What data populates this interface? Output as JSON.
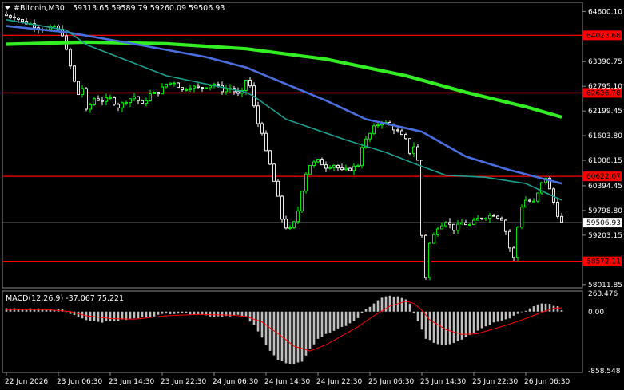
{
  "header": {
    "menu_arrow": "triangle-down-icon",
    "symbol": "#Bitcoin,M30",
    "ohlc": "59313.65 59589.79 59260.09 59506.93"
  },
  "macd_header": "MACD(12,26,9) -37.067 75.221",
  "colors": {
    "background": "#000000",
    "bull": "#00ff00",
    "bear": "#ffffff",
    "ma_fast": "#1e9e8e",
    "ma_mid": "#4a6ee0",
    "ma_slow": "#33ee22",
    "level": "#ff0000",
    "macd_hist": "#c0c0c0",
    "macd_signal": "#ff0000",
    "text": "#ffffff"
  },
  "chart_data": {
    "type": "candlestick",
    "price_ticks": [
      "64600.10",
      "63390.75",
      "62795.10",
      "62199.45",
      "61603.80",
      "61008.15",
      "60394.45",
      "59798.80",
      "59203.15",
      "58011.85"
    ],
    "levels": [
      {
        "label": "64023.68",
        "value": 64023.68
      },
      {
        "label": "62636.78",
        "value": 62636.78
      },
      {
        "label": "60622.07",
        "value": 60622.07
      },
      {
        "label": "58572.11",
        "value": 58572.11
      }
    ],
    "current_price": {
      "label": "59506.93",
      "value": 59506.93
    },
    "x_ticks": [
      "22 Jun 2026",
      "23 Jun 06:30",
      "23 Jun 14:30",
      "23 Jun 22:30",
      "24 Jun 06:30",
      "24 Jun 14:30",
      "24 Jun 22:30",
      "25 Jun 06:30",
      "25 Jun 14:30",
      "25 Jun 22:30",
      "26 Jun 06:30"
    ],
    "ylim": [
      57950,
      64800
    ],
    "close_path": [
      [
        0,
        64500
      ],
      [
        2,
        64480
      ],
      [
        4,
        64350
      ],
      [
        6,
        64300
      ],
      [
        8,
        64200
      ],
      [
        10,
        64150
      ],
      [
        12,
        64250
      ],
      [
        14,
        64050
      ],
      [
        15,
        63650
      ],
      [
        17,
        62900
      ],
      [
        18,
        62600
      ],
      [
        19,
        62750
      ],
      [
        20,
        62200
      ],
      [
        22,
        62500
      ],
      [
        24,
        62450
      ],
      [
        26,
        62500
      ],
      [
        28,
        62300
      ],
      [
        30,
        62450
      ],
      [
        32,
        62550
      ],
      [
        34,
        62350
      ],
      [
        36,
        62600
      ],
      [
        38,
        62650
      ],
      [
        40,
        62850
      ],
      [
        42,
        62900
      ],
      [
        44,
        62700
      ],
      [
        46,
        62800
      ],
      [
        48,
        62750
      ],
      [
        50,
        62800
      ],
      [
        52,
        62850
      ],
      [
        54,
        62700
      ],
      [
        56,
        62750
      ],
      [
        58,
        62600
      ],
      [
        59,
        62650
      ],
      [
        60,
        62950
      ],
      [
        61,
        62800
      ],
      [
        62,
        62300
      ],
      [
        63,
        61900
      ],
      [
        64,
        61700
      ],
      [
        65,
        61200
      ],
      [
        66,
        60900
      ],
      [
        67,
        60500
      ],
      [
        68,
        60100
      ],
      [
        69,
        59600
      ],
      [
        70,
        59400
      ],
      [
        71,
        59350
      ],
      [
        72,
        59500
      ],
      [
        73,
        59800
      ],
      [
        74,
        60300
      ],
      [
        75,
        60700
      ],
      [
        76,
        60900
      ],
      [
        78,
        61000
      ],
      [
        80,
        60850
      ],
      [
        82,
        60900
      ],
      [
        84,
        60750
      ],
      [
        86,
        60800
      ],
      [
        88,
        60900
      ],
      [
        89,
        61350
      ],
      [
        90,
        61500
      ],
      [
        92,
        61800
      ],
      [
        94,
        61950
      ],
      [
        96,
        61850
      ],
      [
        98,
        61700
      ],
      [
        100,
        61500
      ],
      [
        101,
        61200
      ],
      [
        102,
        61350
      ],
      [
        103,
        61000
      ],
      [
        104,
        59200
      ],
      [
        105,
        58200
      ],
      [
        106,
        59000
      ],
      [
        108,
        59400
      ],
      [
        110,
        59550
      ],
      [
        112,
        59350
      ],
      [
        114,
        59500
      ],
      [
        116,
        59450
      ],
      [
        118,
        59600
      ],
      [
        120,
        59650
      ],
      [
        122,
        59700
      ],
      [
        124,
        59600
      ],
      [
        125,
        59300
      ],
      [
        126,
        58900
      ],
      [
        127,
        58650
      ],
      [
        128,
        59400
      ],
      [
        129,
        59900
      ],
      [
        130,
        60050
      ],
      [
        132,
        60000
      ],
      [
        133,
        60200
      ],
      [
        134,
        60450
      ],
      [
        135,
        60600
      ],
      [
        136,
        60300
      ],
      [
        137,
        60000
      ],
      [
        138,
        59700
      ],
      [
        139,
        59500
      ]
    ],
    "ma_fast": [
      [
        0,
        64400
      ],
      [
        15,
        64150
      ],
      [
        20,
        63800
      ],
      [
        40,
        63050
      ],
      [
        60,
        62650
      ],
      [
        62,
        62550
      ],
      [
        70,
        62000
      ],
      [
        85,
        61500
      ],
      [
        95,
        61200
      ],
      [
        103,
        60900
      ],
      [
        110,
        60650
      ],
      [
        120,
        60600
      ],
      [
        130,
        60450
      ],
      [
        139,
        60050
      ]
    ],
    "ma_mid": [
      [
        0,
        64250
      ],
      [
        15,
        64100
      ],
      [
        30,
        63850
      ],
      [
        50,
        63500
      ],
      [
        60,
        63250
      ],
      [
        80,
        62450
      ],
      [
        90,
        62000
      ],
      [
        104,
        61700
      ],
      [
        115,
        61100
      ],
      [
        125,
        60800
      ],
      [
        139,
        60450
      ]
    ],
    "ma_slow": [
      [
        0,
        63810
      ],
      [
        20,
        63860
      ],
      [
        40,
        63820
      ],
      [
        60,
        63700
      ],
      [
        80,
        63450
      ],
      [
        100,
        63050
      ],
      [
        115,
        62650
      ],
      [
        130,
        62300
      ],
      [
        139,
        62050
      ]
    ],
    "macd": {
      "ticks": [
        "263.476",
        "0.00",
        "-858.548"
      ],
      "ylim": [
        -858.548,
        263.476
      ],
      "hist": [
        [
          0,
          40
        ],
        [
          8,
          40
        ],
        [
          14,
          30
        ],
        [
          16,
          -30
        ],
        [
          20,
          -120
        ],
        [
          24,
          -150
        ],
        [
          28,
          -130
        ],
        [
          32,
          -100
        ],
        [
          36,
          -70
        ],
        [
          40,
          -30
        ],
        [
          44,
          -20
        ],
        [
          48,
          -40
        ],
        [
          52,
          -70
        ],
        [
          56,
          -60
        ],
        [
          58,
          -50
        ],
        [
          60,
          -80
        ],
        [
          62,
          -200
        ],
        [
          64,
          -380
        ],
        [
          66,
          -560
        ],
        [
          68,
          -700
        ],
        [
          70,
          -750
        ],
        [
          72,
          -770
        ],
        [
          74,
          -720
        ],
        [
          76,
          -540
        ],
        [
          78,
          -400
        ],
        [
          80,
          -320
        ],
        [
          84,
          -230
        ],
        [
          88,
          -100
        ],
        [
          90,
          30
        ],
        [
          92,
          120
        ],
        [
          94,
          200
        ],
        [
          96,
          230
        ],
        [
          98,
          215
        ],
        [
          100,
          170
        ],
        [
          101,
          110
        ],
        [
          102,
          -30
        ],
        [
          104,
          -250
        ],
        [
          105,
          -400
        ],
        [
          106,
          -420
        ],
        [
          108,
          -470
        ],
        [
          110,
          -480
        ],
        [
          112,
          -450
        ],
        [
          114,
          -400
        ],
        [
          116,
          -330
        ],
        [
          118,
          -270
        ],
        [
          120,
          -210
        ],
        [
          122,
          -160
        ],
        [
          124,
          -120
        ],
        [
          126,
          -90
        ],
        [
          128,
          -30
        ],
        [
          130,
          20
        ],
        [
          132,
          70
        ],
        [
          134,
          120
        ],
        [
          136,
          110
        ],
        [
          138,
          70
        ],
        [
          139,
          20
        ]
      ],
      "signal": [
        [
          0,
          30
        ],
        [
          10,
          30
        ],
        [
          16,
          0
        ],
        [
          20,
          -60
        ],
        [
          26,
          -100
        ],
        [
          32,
          -110
        ],
        [
          40,
          -60
        ],
        [
          48,
          -40
        ],
        [
          56,
          -50
        ],
        [
          60,
          -70
        ],
        [
          64,
          -150
        ],
        [
          68,
          -320
        ],
        [
          72,
          -500
        ],
        [
          76,
          -570
        ],
        [
          80,
          -480
        ],
        [
          84,
          -350
        ],
        [
          88,
          -220
        ],
        [
          92,
          -60
        ],
        [
          96,
          80
        ],
        [
          100,
          150
        ],
        [
          102,
          120
        ],
        [
          104,
          20
        ],
        [
          106,
          -120
        ],
        [
          110,
          -260
        ],
        [
          114,
          -330
        ],
        [
          118,
          -320
        ],
        [
          122,
          -250
        ],
        [
          126,
          -180
        ],
        [
          130,
          -100
        ],
        [
          134,
          -10
        ],
        [
          137,
          50
        ],
        [
          139,
          55
        ]
      ]
    }
  }
}
